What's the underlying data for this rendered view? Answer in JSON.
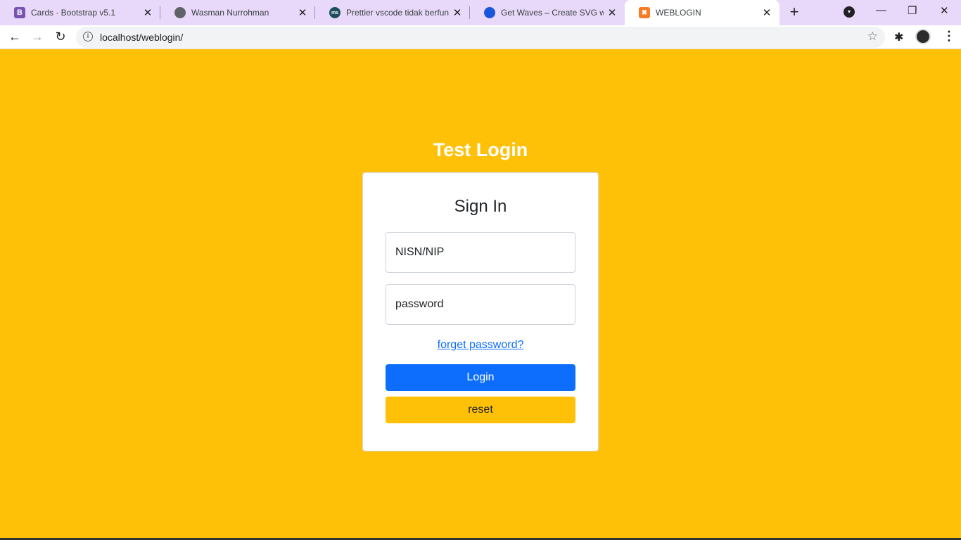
{
  "browser": {
    "tabs": [
      {
        "title": "Cards · Bootstrap v5.1",
        "icon": "bootstrap-icon",
        "color": "#7952b3",
        "glyph": "B"
      },
      {
        "title": "Wasman Nurrohman",
        "icon": "globe-icon",
        "color": "#5f6368",
        "glyph": "◍"
      },
      {
        "title": "Prettier vscode tidak berfungsi",
        "icon": "ms-icon",
        "color": "#1e4d5c",
        "glyph": "ms"
      },
      {
        "title": "Get Waves – Create SVG waves",
        "icon": "waves-icon",
        "color": "#1a56db",
        "glyph": "●"
      },
      {
        "title": "WEBLOGIN",
        "icon": "xampp-icon",
        "color": "#fb7a24",
        "glyph": "✖"
      }
    ],
    "close_glyph": "✕",
    "new_tab_glyph": "+",
    "url": "localhost/weblogin/"
  },
  "page": {
    "heading": "Test Login",
    "card_title": "Sign In",
    "username_placeholder": "NISN/NIP",
    "password_placeholder": "password",
    "forget_link": "forget password?",
    "login_button": "Login",
    "reset_button": "reset"
  },
  "colors": {
    "background": "#ffc107",
    "primary": "#0d6efd",
    "warning": "#ffc107"
  }
}
